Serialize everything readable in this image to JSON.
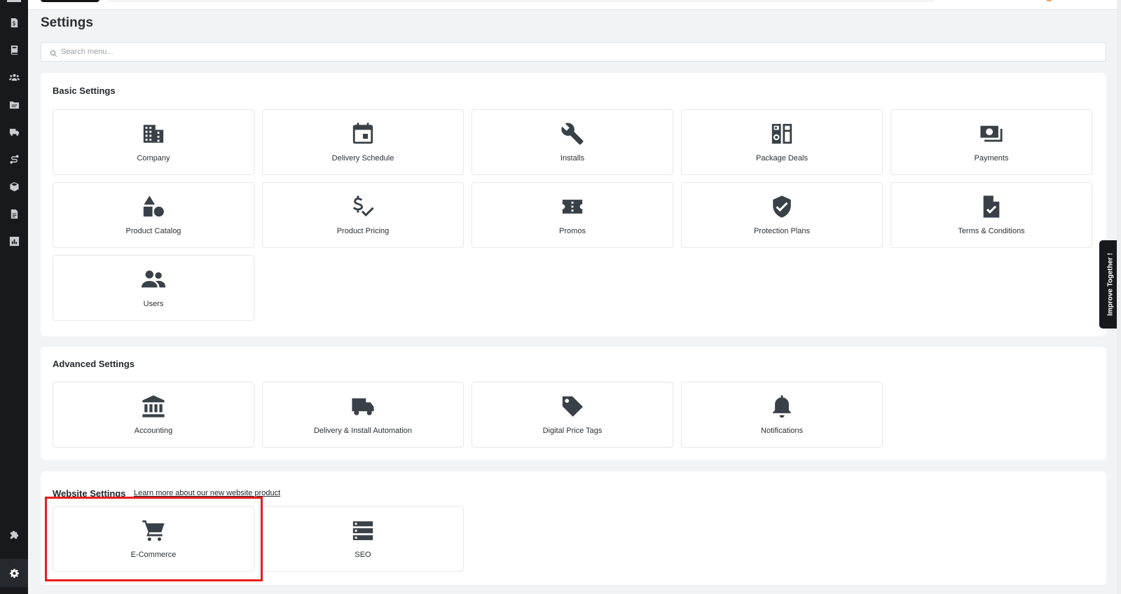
{
  "page": {
    "title": "Settings"
  },
  "search": {
    "placeholder": "Search menu..."
  },
  "sidebar": {
    "items": [
      {
        "icon": "invoice-icon"
      },
      {
        "icon": "book-icon"
      },
      {
        "icon": "users-icon"
      },
      {
        "icon": "folder-icon"
      },
      {
        "icon": "truck-icon"
      },
      {
        "icon": "route-icon"
      },
      {
        "icon": "box-icon"
      },
      {
        "icon": "document-icon"
      },
      {
        "icon": "chart-icon"
      },
      {
        "icon": "puzzle-icon"
      },
      {
        "icon": "gear-icon",
        "active": true
      }
    ]
  },
  "sections": {
    "basic": {
      "title": "Basic Settings",
      "items": [
        {
          "label": "Company",
          "icon": "building-icon"
        },
        {
          "label": "Delivery Schedule",
          "icon": "calendar-icon"
        },
        {
          "label": "Installs",
          "icon": "wrench-icon"
        },
        {
          "label": "Package Deals",
          "icon": "appliances-icon"
        },
        {
          "label": "Payments",
          "icon": "cash-icon"
        },
        {
          "label": "Product Catalog",
          "icon": "shapes-icon"
        },
        {
          "label": "Product Pricing",
          "icon": "dollar-check-icon"
        },
        {
          "label": "Promos",
          "icon": "ticket-icon"
        },
        {
          "label": "Protection Plans",
          "icon": "shield-check-icon"
        },
        {
          "label": "Terms & Conditions",
          "icon": "file-check-icon"
        },
        {
          "label": "Users",
          "icon": "users-icon"
        }
      ]
    },
    "advanced": {
      "title": "Advanced Settings",
      "items": [
        {
          "label": "Accounting",
          "icon": "bank-icon"
        },
        {
          "label": "Delivery & Install Automation",
          "icon": "truck-icon"
        },
        {
          "label": "Digital Price Tags",
          "icon": "tag-icon"
        },
        {
          "label": "Notifications",
          "icon": "bell-icon"
        }
      ]
    },
    "website": {
      "title": "Website Settings",
      "link": "Learn more about our new website product",
      "items": [
        {
          "label": "E-Commerce",
          "icon": "cart-icon",
          "highlighted": true
        },
        {
          "label": "SEO",
          "icon": "list-icon"
        }
      ]
    }
  },
  "feedback": {
    "label": "Improve Together !"
  },
  "colors": {
    "sidebar": "#17191c",
    "highlight": "#ea1c1c",
    "icon": "#3a4047"
  }
}
